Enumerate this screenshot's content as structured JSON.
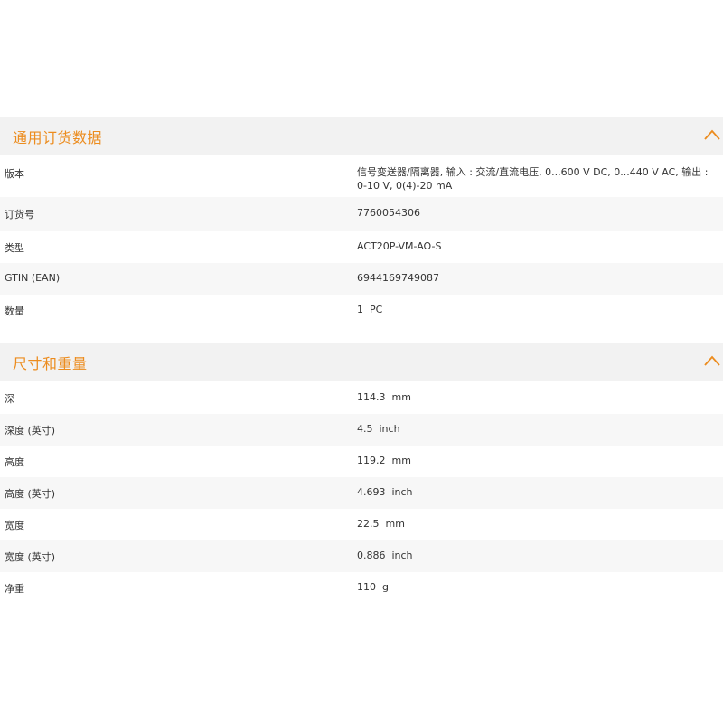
{
  "sections": [
    {
      "title": "通用订货数据",
      "rows": [
        {
          "label": "版本",
          "value": "信号变送器/隔离器, 输入 : 交流/直流电压, 0...600 V DC, 0...440 V AC, 输出 : 0-10 V, 0(4)-20 mA"
        },
        {
          "label": "订货号",
          "value": "7760054306"
        },
        {
          "label": "类型",
          "value": "ACT20P-VM-AO-S"
        },
        {
          "label": "GTIN (EAN)",
          "value": "6944169749087"
        },
        {
          "label": "数量",
          "value": "1  PC"
        }
      ]
    },
    {
      "title": "尺寸和重量",
      "rows": [
        {
          "label": "深",
          "value": "114.3  mm"
        },
        {
          "label": "深度 (英寸)",
          "value": "4.5  inch"
        },
        {
          "label": "高度",
          "value": "119.2  mm"
        },
        {
          "label": "高度 (英寸)",
          "value": "4.693  inch"
        },
        {
          "label": "宽度",
          "value": "22.5  mm"
        },
        {
          "label": "宽度 (英寸)",
          "value": "0.886  inch"
        },
        {
          "label": "净重",
          "value": "110  g"
        }
      ]
    }
  ],
  "icons": {
    "collapse": "chevron-up-icon",
    "accent_color": "#ec8c1e"
  }
}
